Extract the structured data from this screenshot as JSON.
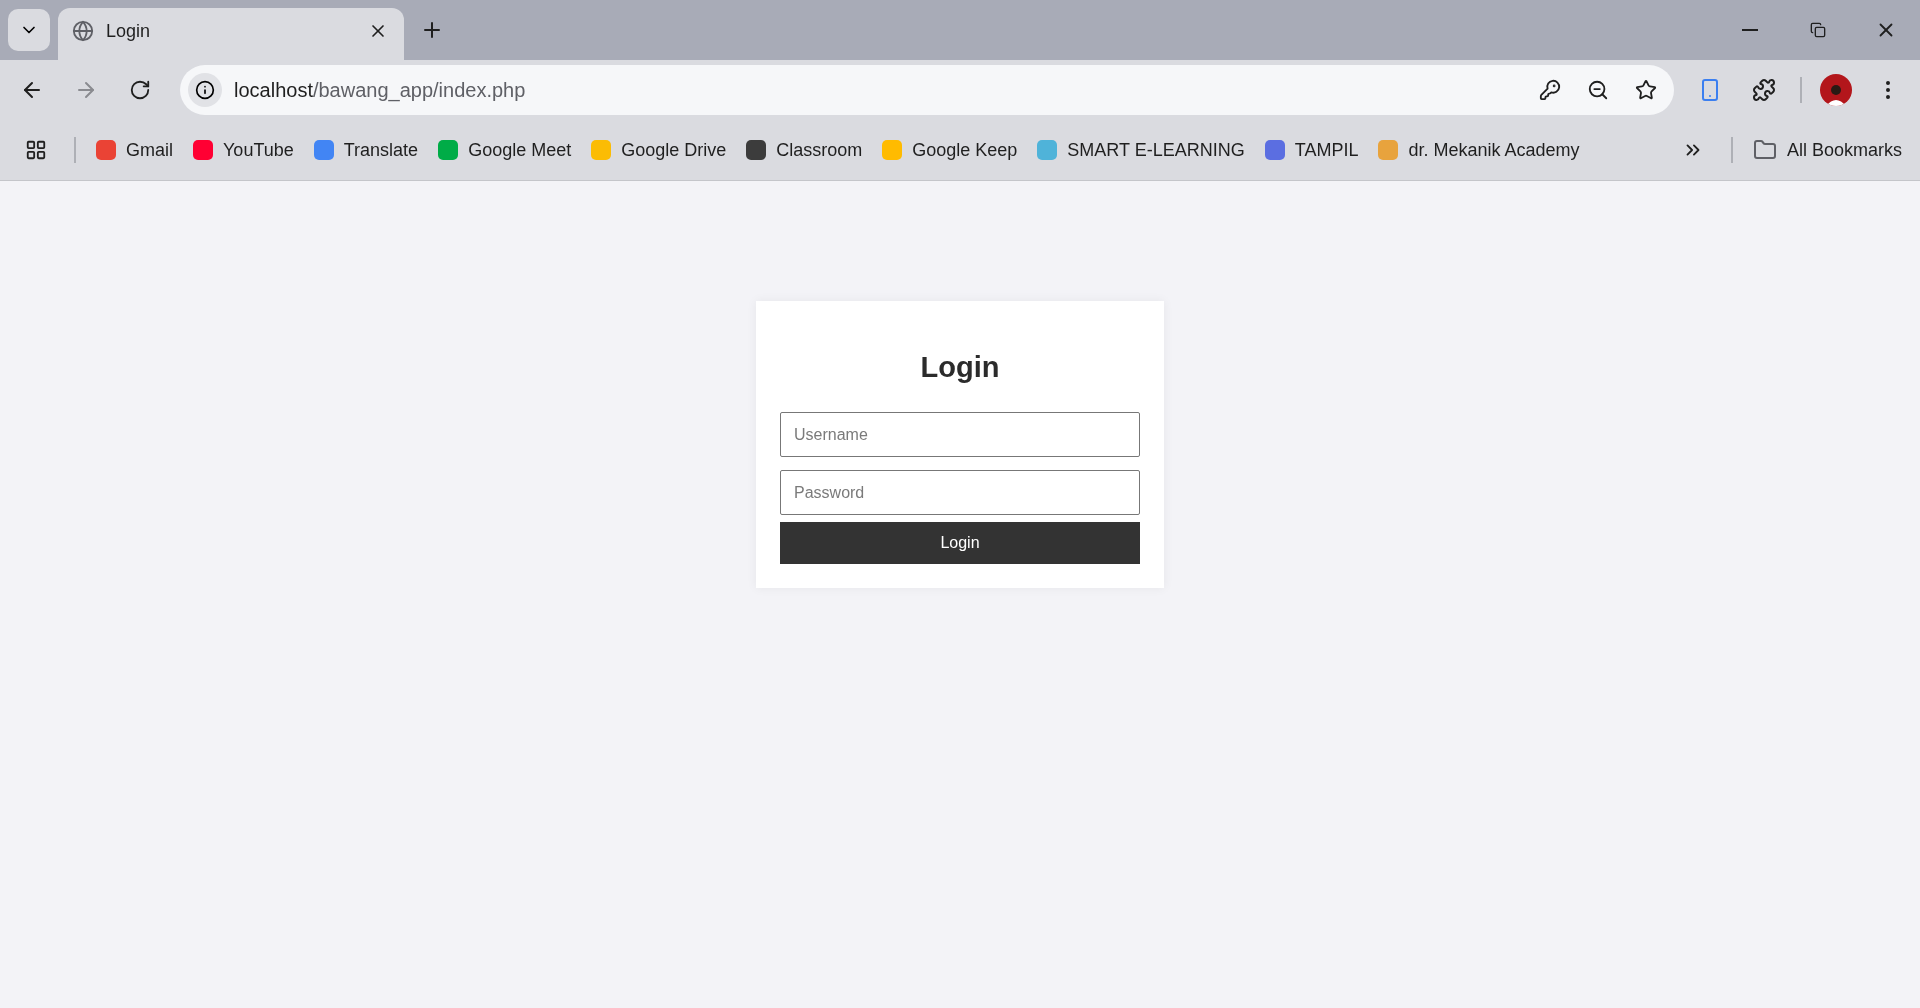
{
  "tabs": [
    {
      "title": "Login",
      "selected": true
    }
  ],
  "address_bar": {
    "host": "localhost",
    "path": "/bawang_app/index.php"
  },
  "bookmarks": [
    {
      "label": "Gmail",
      "color": "#ea4335"
    },
    {
      "label": "YouTube",
      "color": "#ff0033"
    },
    {
      "label": "Translate",
      "color": "#4285f4"
    },
    {
      "label": "Google Meet",
      "color": "#00ac47"
    },
    {
      "label": "Google Drive",
      "color": "#fbbc04"
    },
    {
      "label": "Classroom",
      "color": "#3c3c3c"
    },
    {
      "label": "Google Keep",
      "color": "#ffbb00"
    },
    {
      "label": "SMART E-LEARNING",
      "color": "#4fb3d9"
    },
    {
      "label": "TAMPIL",
      "color": "#5b6ee1"
    },
    {
      "label": "dr. Mekanik Academy",
      "color": "#e8a33d"
    }
  ],
  "all_bookmarks": "All Bookmarks",
  "login_form": {
    "title": "Login",
    "username_placeholder": "Username",
    "password_placeholder": "Password",
    "button": "Login"
  }
}
